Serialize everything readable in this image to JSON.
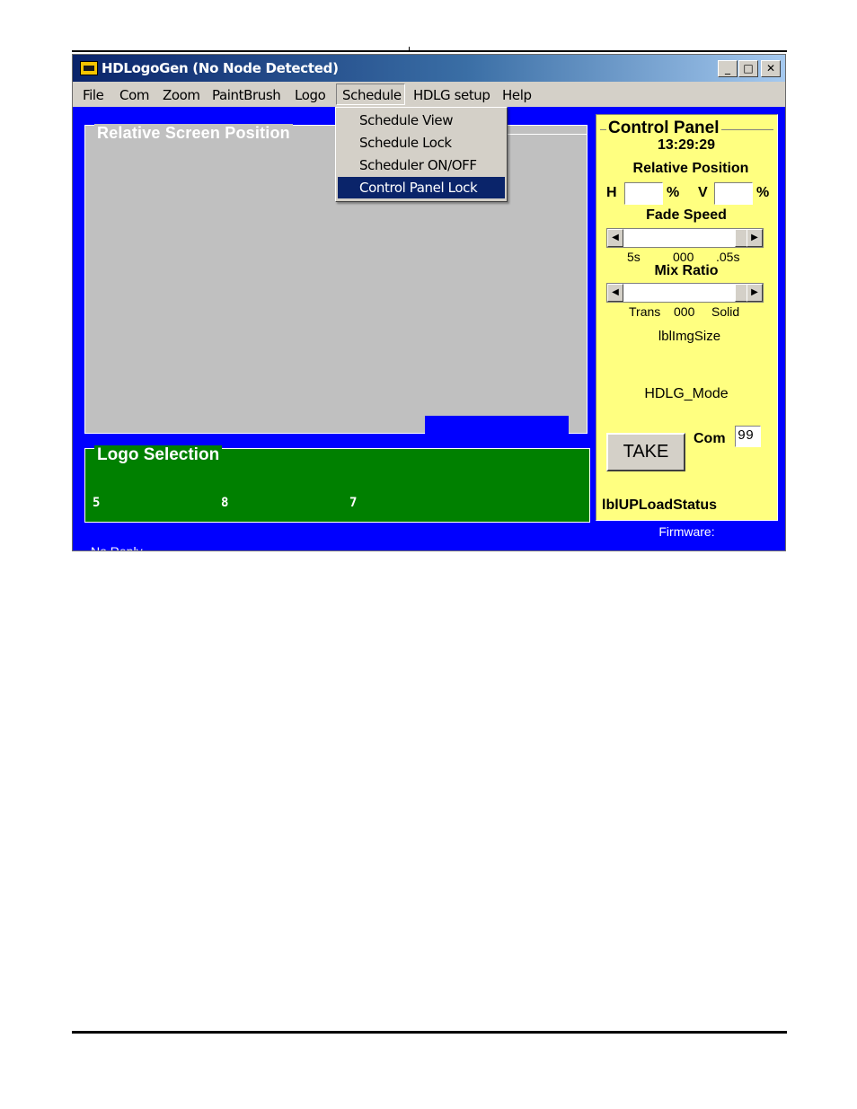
{
  "window": {
    "title": "HDLogoGen (No Node Detected)",
    "controls": {
      "minimize": "_",
      "maximize": "□",
      "close": "✕"
    }
  },
  "menu": {
    "items": [
      "File",
      "Com",
      "Zoom",
      "PaintBrush",
      "Logo",
      "Schedule",
      "HDLG setup",
      "Help"
    ],
    "open": "Schedule",
    "dropdown": [
      "Schedule View",
      "Schedule Lock",
      "Scheduler ON/OFF",
      "Control Panel Lock"
    ],
    "highlighted": "Control Panel Lock"
  },
  "screen_position": {
    "title": "Relative Screen Position"
  },
  "logo_selection": {
    "title": "Logo Selection",
    "numbers": [
      "5",
      "8",
      "7"
    ]
  },
  "status": {
    "reply": "No Reply",
    "firmware": "Firmware:"
  },
  "control_panel": {
    "title": "Control Panel",
    "time": "13:29:29",
    "relative_position": "Relative Position",
    "h_label": "H",
    "v_label": "V",
    "percent": "%",
    "h_value": "",
    "v_value": "",
    "fade_speed": "Fade Speed",
    "fade_scale": {
      "left": "5s",
      "mid": "000",
      "right": ".05s"
    },
    "mix_ratio": "Mix Ratio",
    "mix_scale": {
      "left": "Trans",
      "mid": "000",
      "right": "Solid"
    },
    "img_size": "lblImgSize",
    "mode": "HDLG_Mode",
    "take": "TAKE",
    "com_label": "Com",
    "com_value": "99",
    "upload_status": "lblUPLoadStatus"
  },
  "colors": {
    "window_bg": "#0000ff",
    "control_panel_bg": "#ffff80",
    "logo_selection_bg": "#008000",
    "screen_bg": "#c0c0c0",
    "menu_highlight": "#0a246a"
  }
}
